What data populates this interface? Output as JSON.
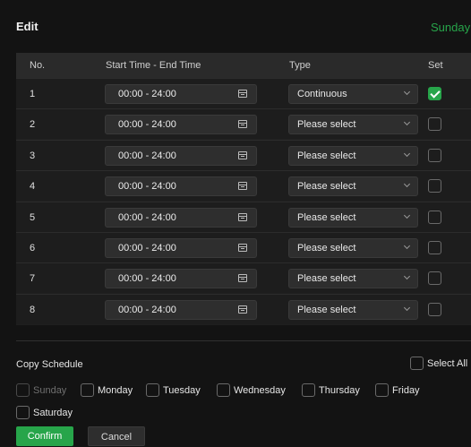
{
  "header": {
    "title": "Edit",
    "day": "Sunday"
  },
  "table": {
    "columns": {
      "no": "No.",
      "time": "Start Time - End Time",
      "type": "Type",
      "set": "Set"
    },
    "rows": [
      {
        "no": "1",
        "time": "00:00 - 24:00",
        "type": "Continuous",
        "checked": true
      },
      {
        "no": "2",
        "time": "00:00 - 24:00",
        "type": "Please select",
        "checked": false
      },
      {
        "no": "3",
        "time": "00:00 - 24:00",
        "type": "Please select",
        "checked": false
      },
      {
        "no": "4",
        "time": "00:00 - 24:00",
        "type": "Please select",
        "checked": false
      },
      {
        "no": "5",
        "time": "00:00 - 24:00",
        "type": "Please select",
        "checked": false
      },
      {
        "no": "6",
        "time": "00:00 - 24:00",
        "type": "Please select",
        "checked": false
      },
      {
        "no": "7",
        "time": "00:00 - 24:00",
        "type": "Please select",
        "checked": false
      },
      {
        "no": "8",
        "time": "00:00 - 24:00",
        "type": "Please select",
        "checked": false
      }
    ]
  },
  "copy": {
    "label": "Copy Schedule",
    "select_all": "Select All",
    "days": [
      "Sunday",
      "Monday",
      "Tuesday",
      "Wednesday",
      "Thursday",
      "Friday",
      "Saturday"
    ]
  },
  "buttons": {
    "confirm": "Confirm",
    "cancel": "Cancel"
  },
  "colors": {
    "accent": "#27a54a",
    "background": "#131313"
  }
}
